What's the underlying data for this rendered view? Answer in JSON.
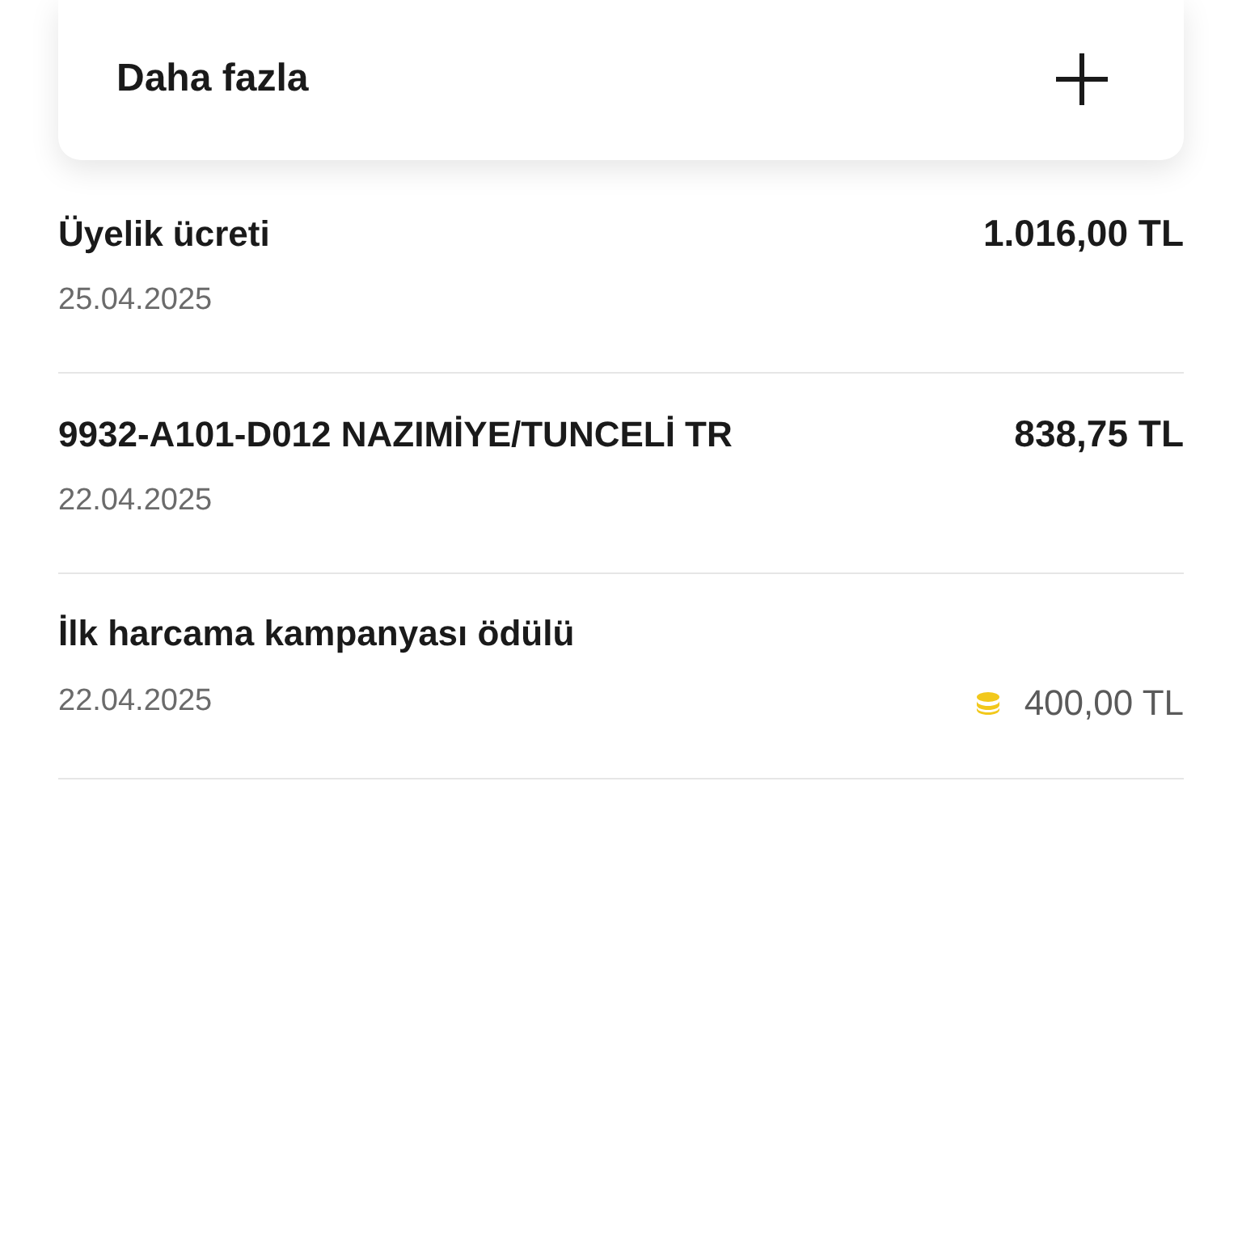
{
  "more_card": {
    "label": "Daha fazla"
  },
  "transactions": [
    {
      "kind": "charge",
      "title": "Üyelik ücreti",
      "date": "25.04.2025",
      "amount": "1.016,00 TL"
    },
    {
      "kind": "charge",
      "title": "9932-A101-D012 NAZIMİYE/TUNCELİ TR",
      "date": "22.04.2025",
      "amount": "838,75 TL"
    },
    {
      "kind": "reward",
      "title": "İlk harcama kampanyası ödülü",
      "date": "22.04.2025",
      "amount": "400,00 TL"
    }
  ]
}
